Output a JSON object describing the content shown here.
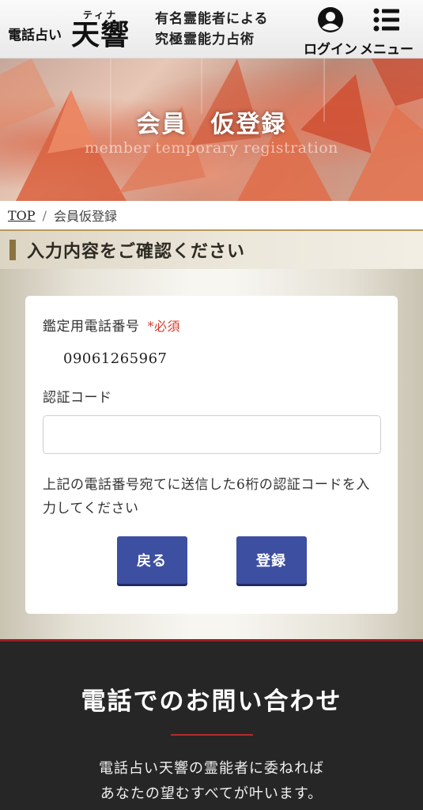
{
  "header": {
    "logo_sub": "電話占い",
    "logo_ruby": "ティナ",
    "logo_main": "天響",
    "tagline_line1": "有名霊能者による",
    "tagline_line2": "究極霊能力占術",
    "login_label": "ログイン",
    "menu_label": "メニュー"
  },
  "hero": {
    "title_part1": "会員",
    "title_part2": "仮登録",
    "subtitle": "member temporary registration"
  },
  "breadcrumb": {
    "home": "TOP",
    "separator": "/",
    "current": "会員仮登録"
  },
  "section": {
    "heading": "入力内容をご確認ください"
  },
  "form": {
    "phone_label": "鑑定用電話番号",
    "required_mark": "*必須",
    "phone_value": "09061265967",
    "code_label": "認証コード",
    "code_value": "",
    "code_placeholder": "",
    "note": "上記の電話番号宛てに送信した6桁の認証コードを入力してください",
    "back_button": "戻る",
    "submit_button": "登録"
  },
  "footer": {
    "title": "電話でのお問い合わせ",
    "text_line1": "電話占い天響の霊能者に委ねれば",
    "text_line2": "あなたの望むすべてが叶います。"
  },
  "colors": {
    "primary_button": "#3d4fa0",
    "required": "#d63b2f",
    "accent_gold": "#8a7340",
    "footer_bg": "#262626",
    "footer_accent": "#b32b2b"
  }
}
